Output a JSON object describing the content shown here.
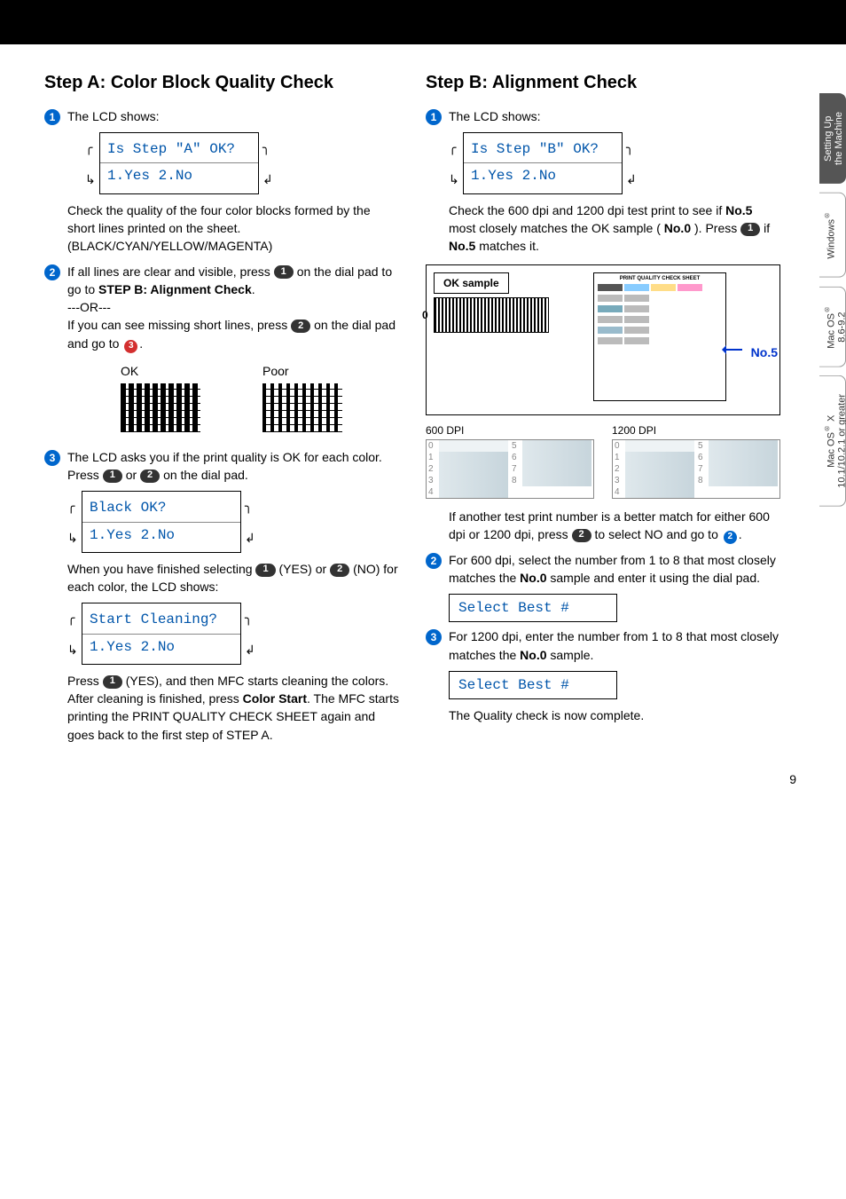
{
  "pageNumber": "9",
  "stepA": {
    "title": "Step A:  Color Block Quality Check",
    "s1_intro": "The LCD shows:",
    "lcd1_line1": "Is Step \"A\" OK?",
    "lcd1_line2": "1.Yes 2.No",
    "s1_body": "Check the quality of the four color blocks formed by the short lines printed on the sheet.\n(BLACK/CYAN/YELLOW/MAGENTA)",
    "s2_a": "If all lines are clear and visible, press ",
    "s2_b": " on the dial pad to go to ",
    "s2_bold": "STEP B: Alignment Check",
    "s2_c": ".",
    "or": "---OR---",
    "s2_d": "If you can see missing short lines, press ",
    "s2_e": " on the dial pad and go to ",
    "s2_f": ".",
    "ok_label": "OK",
    "poor_label": "Poor",
    "s3_a": "The LCD asks you if the print quality is OK for each color. Press ",
    "s3_b": " or ",
    "s3_c": " on the dial pad.",
    "lcd2_line1": "Black OK?",
    "lcd2_line2": "1.Yes 2.No",
    "s3_d": "When you have finished selecting ",
    "s3_e": " (YES) or ",
    "s3_f": " (NO) for each color, the LCD shows:",
    "lcd3_line1": "Start Cleaning?",
    "lcd3_line2": "1.Yes 2.No",
    "s3_g": "Press ",
    "s3_h": " (YES), and then MFC starts cleaning the colors.",
    "s3_i": "After cleaning is finished, press ",
    "s3_i_bold": "Color Start",
    "s3_i2": ". The MFC starts printing the PRINT QUALITY CHECK SHEET again and goes back to the first step of STEP A."
  },
  "stepB": {
    "title": "Step B:  Alignment Check",
    "s1_intro": "The LCD shows:",
    "lcd1_line1": "Is Step \"B\" OK?",
    "lcd1_line2": "1.Yes 2.No",
    "s1_a": "Check the 600 dpi and 1200 dpi test print to see if ",
    "s1_b_bold": "No.5",
    "s1_c": " most closely matches the OK sample (",
    "s1_d_bold": "No.0",
    "s1_e": "). Press ",
    "s1_f": " if ",
    "s1_g_bold": "No.5",
    "s1_h": " matches it.",
    "ok_sample": "OK sample",
    "no5": "No.5",
    "dpi600": "600 DPI",
    "dpi1200": "1200 DPI",
    "sheet_title": "PRINT QUALITY CHECK SHEET",
    "s1_i": "If another test print number is a better match for either 600 dpi or 1200 dpi, press ",
    "s1_j": " to select NO and go to ",
    "s1_k": ".",
    "s2_a": "For 600 dpi, select the number from 1 to 8 that most closely matches the ",
    "s2_bold": "No.0",
    "s2_b": " sample and enter it using the dial pad.",
    "lcd_select": "Select Best #",
    "s3_a": "For 1200 dpi, enter the number from 1 to 8 that most closely matches the ",
    "s3_bold": "No.0",
    "s3_b": " sample.",
    "complete": "The Quality check is now complete."
  },
  "tabs": {
    "t1": "Setting Up\nthe Machine",
    "t2": "Windows®",
    "t3": "Mac OS®\n8.6-9.2",
    "t4": "Mac OS® X\n10.1/10.2.1 or greater"
  },
  "keys": {
    "k1": "1",
    "k2": "2"
  },
  "dpi_rows": [
    "0",
    "1",
    "2",
    "3",
    "4",
    "5",
    "6",
    "7",
    "8"
  ]
}
